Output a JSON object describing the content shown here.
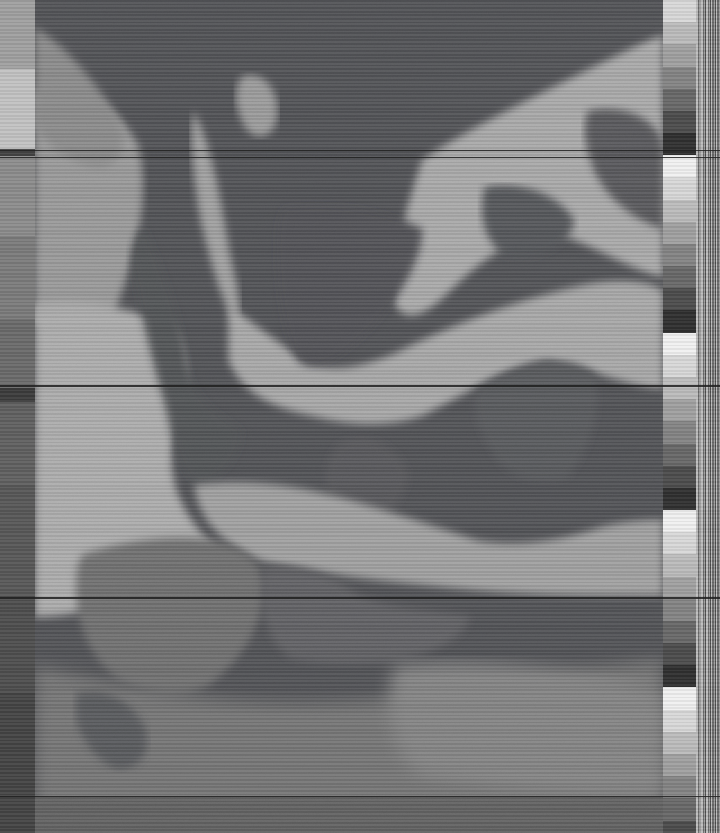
{
  "image": {
    "kind": "noaa-apt-satellite-weather-image",
    "palette": {
      "space": "#15171f",
      "cloud": "#e6e6e6",
      "cloud_mid": "#bcbcbc",
      "land": "#5a5a5a",
      "sea": "#1c1e26",
      "strip_light": "#cfcfcf",
      "strip_dark": "#3a3a3a"
    }
  }
}
